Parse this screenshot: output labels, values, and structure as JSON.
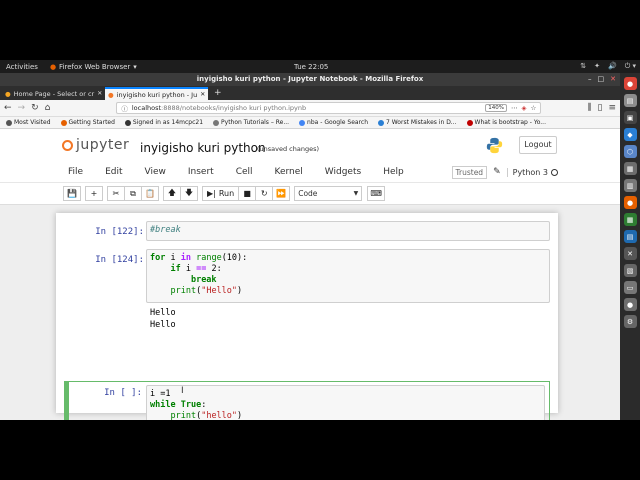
{
  "topbar": {
    "activities": "Activities",
    "app": "Firefox Web Browser",
    "app_caret": "▾",
    "clock": "Tue 22:05",
    "tray": [
      "⇅",
      "✦",
      "🔊",
      "⏻ ▾"
    ]
  },
  "firefox": {
    "window_title": "inyigisho kuri python - Jupyter Notebook - Mozilla Firefox",
    "tabs": [
      {
        "label": "Home Page - Select or cr",
        "close": "✕"
      },
      {
        "label": "inyigisho kuri python - Ju",
        "close": "✕"
      }
    ],
    "new_tab": "+",
    "url_host": "localhost",
    "url_path": ":8888/notebooks/inyigisho kuri python.ipynb",
    "zoom": "140%",
    "bookmarks": [
      {
        "label": "Most Visited",
        "color": "#555555"
      },
      {
        "label": "Getting Started",
        "color": "#e66000"
      },
      {
        "label": "Signed in as 14mcpc21",
        "color": "#333333"
      },
      {
        "label": "Python Tutorials – Re...",
        "color": "#777777"
      },
      {
        "label": "nba - Google Search",
        "color": "#4285f4"
      },
      {
        "label": "7 Worst Mistakes in D...",
        "color": "#2a7fd4"
      },
      {
        "label": "What is bootstrap - Yo...",
        "color": "#c00000"
      }
    ]
  },
  "jupyter": {
    "logo_text": "jupyter",
    "notebook_name": "inyigisho kuri python",
    "status": "(unsaved changes)",
    "logout": "Logout",
    "menu": [
      "File",
      "Edit",
      "View",
      "Insert",
      "Cell",
      "Kernel",
      "Widgets",
      "Help"
    ],
    "trusted": "Trusted",
    "kernel_name": "Python 3",
    "toolbar": {
      "save": "💾",
      "add": "+",
      "cut": "✂",
      "copy": "⧉",
      "paste": "📋",
      "up": "🡅",
      "down": "🡇",
      "run_label": "Run",
      "stop": "■",
      "restart": "↻",
      "restart_run": "⏩",
      "cell_type": "Code",
      "keyboard": "⌨"
    },
    "cells": [
      {
        "prompt": "In [122]:",
        "code": "#break"
      },
      {
        "prompt": "In [124]:",
        "output": [
          "Hello",
          "Hello"
        ]
      },
      {
        "prompt": "In [ ]:"
      }
    ],
    "code2": {
      "l1_for": "for",
      "l1_i": " i ",
      "l1_in": "in",
      "l1_range": "range",
      "l1_rest": "(10):",
      "l2_if": "if",
      "l2_rest": " i ",
      "l2_op": "==",
      "l2_num": " 2:",
      "l3_break": "break",
      "l4_print": "print",
      "l4_str": "\"Hello\""
    },
    "code3": {
      "l1": "i =1",
      "l2_while": "while",
      "l2_true": "True",
      "l2_colon": ":",
      "l3_print": "print",
      "l3_str": "\"hello\""
    }
  },
  "dock": [
    {
      "name": "chrome-icon",
      "color": "#db4437",
      "glyph": "●"
    },
    {
      "name": "files-icon",
      "color": "#8d8d8d",
      "glyph": "▤"
    },
    {
      "name": "terminal-icon",
      "color": "#444444",
      "glyph": "▣"
    },
    {
      "name": "vscode-icon",
      "color": "#2a7fd4",
      "glyph": "◆"
    },
    {
      "name": "box-icon",
      "color": "#5a86c8",
      "glyph": "⬡"
    },
    {
      "name": "archive-icon",
      "color": "#6d6d6d",
      "glyph": "▦"
    },
    {
      "name": "store-icon",
      "color": "#777777",
      "glyph": "▥"
    },
    {
      "name": "firefox-icon",
      "color": "#e66000",
      "glyph": "●"
    },
    {
      "name": "sheet-icon",
      "color": "#2e7d32",
      "glyph": "▦"
    },
    {
      "name": "doc-icon",
      "color": "#1e6ab0",
      "glyph": "▤"
    },
    {
      "name": "x-icon",
      "color": "#555555",
      "glyph": "✕"
    },
    {
      "name": "image-icon",
      "color": "#666666",
      "glyph": "▧"
    },
    {
      "name": "slides-icon",
      "color": "#777777",
      "glyph": "▭"
    },
    {
      "name": "mic-icon",
      "color": "#6e6e6e",
      "glyph": "●"
    },
    {
      "name": "settings-icon",
      "color": "#666666",
      "glyph": "⚙"
    }
  ]
}
